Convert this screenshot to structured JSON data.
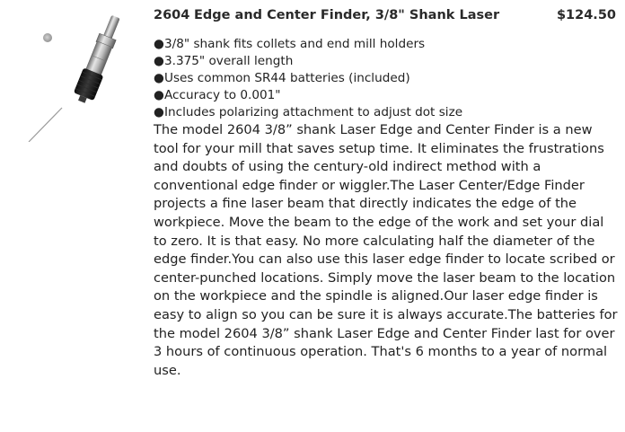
{
  "product": {
    "model": "2604",
    "title": "Edge and Center Finder, 3/8\" Shank Laser",
    "price": "$124.50",
    "features": [
      "3/8\" shank fits collets and end mill holders",
      "3.375\" overall length",
      "Uses common SR44 batteries (included)",
      "Accuracy to 0.001\"",
      "Includes polarizing attachment to adjust dot size"
    ],
    "bullet": "●",
    "description": "The model 2604 3/8” shank Laser Edge and Center Finder is a new tool for your mill that saves setup time. It eliminates the frustrations and doubts of using the century-old indirect method with a conventional edge finder or wiggler.The Laser Center/Edge Finder projects a fine laser beam that directly indicates the edge of the workpiece. Move the beam to the edge of the work and set your dial to zero. It is that easy. No more calculating half the diameter of the edge finder.You can also use this laser edge finder to locate scribed or center-punched locations. Simply move the laser beam to the location on the workpiece and the spindle is aligned.Our laser edge finder is easy to align so you can be sure it is always accurate.The batteries for the model 2604 3/8” shank Laser Edge and Center Finder last for over 3 hours of continuous operation. That's 6 months to a year of normal use."
  }
}
